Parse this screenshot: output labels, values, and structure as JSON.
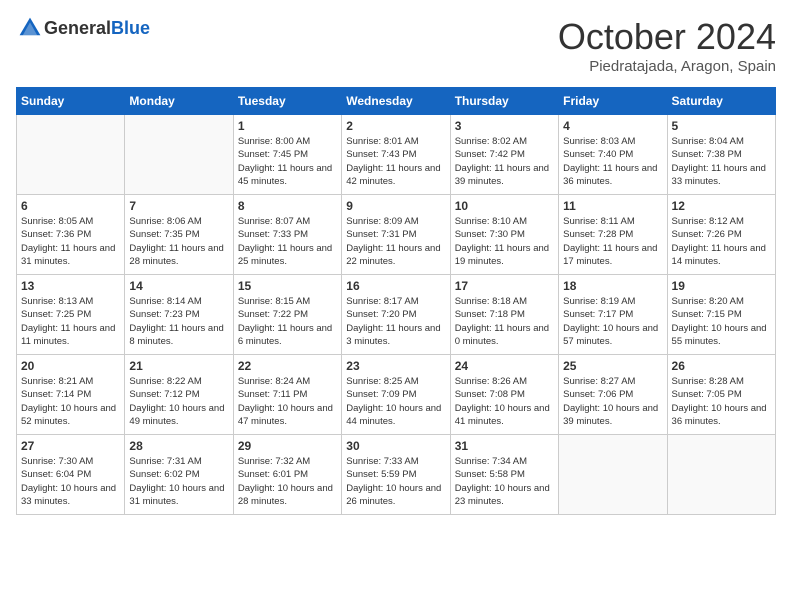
{
  "header": {
    "logo_general": "General",
    "logo_blue": "Blue",
    "month": "October 2024",
    "location": "Piedratajada, Aragon, Spain"
  },
  "days_of_week": [
    "Sunday",
    "Monday",
    "Tuesday",
    "Wednesday",
    "Thursday",
    "Friday",
    "Saturday"
  ],
  "weeks": [
    [
      {
        "day": "",
        "sunrise": "",
        "sunset": "",
        "daylight": ""
      },
      {
        "day": "",
        "sunrise": "",
        "sunset": "",
        "daylight": ""
      },
      {
        "day": "1",
        "sunrise": "Sunrise: 8:00 AM",
        "sunset": "Sunset: 7:45 PM",
        "daylight": "Daylight: 11 hours and 45 minutes."
      },
      {
        "day": "2",
        "sunrise": "Sunrise: 8:01 AM",
        "sunset": "Sunset: 7:43 PM",
        "daylight": "Daylight: 11 hours and 42 minutes."
      },
      {
        "day": "3",
        "sunrise": "Sunrise: 8:02 AM",
        "sunset": "Sunset: 7:42 PM",
        "daylight": "Daylight: 11 hours and 39 minutes."
      },
      {
        "day": "4",
        "sunrise": "Sunrise: 8:03 AM",
        "sunset": "Sunset: 7:40 PM",
        "daylight": "Daylight: 11 hours and 36 minutes."
      },
      {
        "day": "5",
        "sunrise": "Sunrise: 8:04 AM",
        "sunset": "Sunset: 7:38 PM",
        "daylight": "Daylight: 11 hours and 33 minutes."
      }
    ],
    [
      {
        "day": "6",
        "sunrise": "Sunrise: 8:05 AM",
        "sunset": "Sunset: 7:36 PM",
        "daylight": "Daylight: 11 hours and 31 minutes."
      },
      {
        "day": "7",
        "sunrise": "Sunrise: 8:06 AM",
        "sunset": "Sunset: 7:35 PM",
        "daylight": "Daylight: 11 hours and 28 minutes."
      },
      {
        "day": "8",
        "sunrise": "Sunrise: 8:07 AM",
        "sunset": "Sunset: 7:33 PM",
        "daylight": "Daylight: 11 hours and 25 minutes."
      },
      {
        "day": "9",
        "sunrise": "Sunrise: 8:09 AM",
        "sunset": "Sunset: 7:31 PM",
        "daylight": "Daylight: 11 hours and 22 minutes."
      },
      {
        "day": "10",
        "sunrise": "Sunrise: 8:10 AM",
        "sunset": "Sunset: 7:30 PM",
        "daylight": "Daylight: 11 hours and 19 minutes."
      },
      {
        "day": "11",
        "sunrise": "Sunrise: 8:11 AM",
        "sunset": "Sunset: 7:28 PM",
        "daylight": "Daylight: 11 hours and 17 minutes."
      },
      {
        "day": "12",
        "sunrise": "Sunrise: 8:12 AM",
        "sunset": "Sunset: 7:26 PM",
        "daylight": "Daylight: 11 hours and 14 minutes."
      }
    ],
    [
      {
        "day": "13",
        "sunrise": "Sunrise: 8:13 AM",
        "sunset": "Sunset: 7:25 PM",
        "daylight": "Daylight: 11 hours and 11 minutes."
      },
      {
        "day": "14",
        "sunrise": "Sunrise: 8:14 AM",
        "sunset": "Sunset: 7:23 PM",
        "daylight": "Daylight: 11 hours and 8 minutes."
      },
      {
        "day": "15",
        "sunrise": "Sunrise: 8:15 AM",
        "sunset": "Sunset: 7:22 PM",
        "daylight": "Daylight: 11 hours and 6 minutes."
      },
      {
        "day": "16",
        "sunrise": "Sunrise: 8:17 AM",
        "sunset": "Sunset: 7:20 PM",
        "daylight": "Daylight: 11 hours and 3 minutes."
      },
      {
        "day": "17",
        "sunrise": "Sunrise: 8:18 AM",
        "sunset": "Sunset: 7:18 PM",
        "daylight": "Daylight: 11 hours and 0 minutes."
      },
      {
        "day": "18",
        "sunrise": "Sunrise: 8:19 AM",
        "sunset": "Sunset: 7:17 PM",
        "daylight": "Daylight: 10 hours and 57 minutes."
      },
      {
        "day": "19",
        "sunrise": "Sunrise: 8:20 AM",
        "sunset": "Sunset: 7:15 PM",
        "daylight": "Daylight: 10 hours and 55 minutes."
      }
    ],
    [
      {
        "day": "20",
        "sunrise": "Sunrise: 8:21 AM",
        "sunset": "Sunset: 7:14 PM",
        "daylight": "Daylight: 10 hours and 52 minutes."
      },
      {
        "day": "21",
        "sunrise": "Sunrise: 8:22 AM",
        "sunset": "Sunset: 7:12 PM",
        "daylight": "Daylight: 10 hours and 49 minutes."
      },
      {
        "day": "22",
        "sunrise": "Sunrise: 8:24 AM",
        "sunset": "Sunset: 7:11 PM",
        "daylight": "Daylight: 10 hours and 47 minutes."
      },
      {
        "day": "23",
        "sunrise": "Sunrise: 8:25 AM",
        "sunset": "Sunset: 7:09 PM",
        "daylight": "Daylight: 10 hours and 44 minutes."
      },
      {
        "day": "24",
        "sunrise": "Sunrise: 8:26 AM",
        "sunset": "Sunset: 7:08 PM",
        "daylight": "Daylight: 10 hours and 41 minutes."
      },
      {
        "day": "25",
        "sunrise": "Sunrise: 8:27 AM",
        "sunset": "Sunset: 7:06 PM",
        "daylight": "Daylight: 10 hours and 39 minutes."
      },
      {
        "day": "26",
        "sunrise": "Sunrise: 8:28 AM",
        "sunset": "Sunset: 7:05 PM",
        "daylight": "Daylight: 10 hours and 36 minutes."
      }
    ],
    [
      {
        "day": "27",
        "sunrise": "Sunrise: 7:30 AM",
        "sunset": "Sunset: 6:04 PM",
        "daylight": "Daylight: 10 hours and 33 minutes."
      },
      {
        "day": "28",
        "sunrise": "Sunrise: 7:31 AM",
        "sunset": "Sunset: 6:02 PM",
        "daylight": "Daylight: 10 hours and 31 minutes."
      },
      {
        "day": "29",
        "sunrise": "Sunrise: 7:32 AM",
        "sunset": "Sunset: 6:01 PM",
        "daylight": "Daylight: 10 hours and 28 minutes."
      },
      {
        "day": "30",
        "sunrise": "Sunrise: 7:33 AM",
        "sunset": "Sunset: 5:59 PM",
        "daylight": "Daylight: 10 hours and 26 minutes."
      },
      {
        "day": "31",
        "sunrise": "Sunrise: 7:34 AM",
        "sunset": "Sunset: 5:58 PM",
        "daylight": "Daylight: 10 hours and 23 minutes."
      },
      {
        "day": "",
        "sunrise": "",
        "sunset": "",
        "daylight": ""
      },
      {
        "day": "",
        "sunrise": "",
        "sunset": "",
        "daylight": ""
      }
    ]
  ]
}
